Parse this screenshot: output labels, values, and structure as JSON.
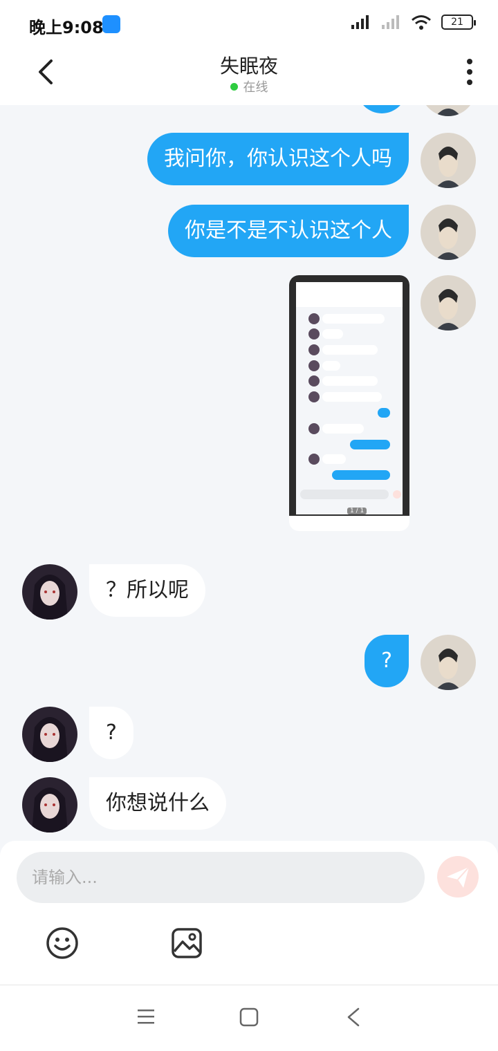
{
  "status": {
    "time": "晚上9:08",
    "battery": "21"
  },
  "header": {
    "title": "失眠夜",
    "status_text": "在线"
  },
  "messages": [
    {
      "from": "me",
      "text": "我问你，你认识这个人吗"
    },
    {
      "from": "me",
      "text": "你是不是不认识这个人"
    },
    {
      "from": "me",
      "type": "image",
      "page": "1 / 1"
    },
    {
      "from": "peer",
      "text": "？所以呢"
    },
    {
      "from": "me",
      "text": "?"
    },
    {
      "from": "peer",
      "text": "?"
    },
    {
      "from": "peer",
      "text": "你想说什么"
    }
  ],
  "composer": {
    "placeholder": "请输入..."
  },
  "colors": {
    "my_bubble": "#22a6f5",
    "peer_bubble": "#ffffff",
    "online": "#2ecc40",
    "send_button": "#fde1dd"
  },
  "icons": [
    "back-icon",
    "more-icon",
    "send-icon",
    "emoji-icon",
    "image-icon",
    "menu-icon",
    "home-icon",
    "nav-back-icon"
  ]
}
